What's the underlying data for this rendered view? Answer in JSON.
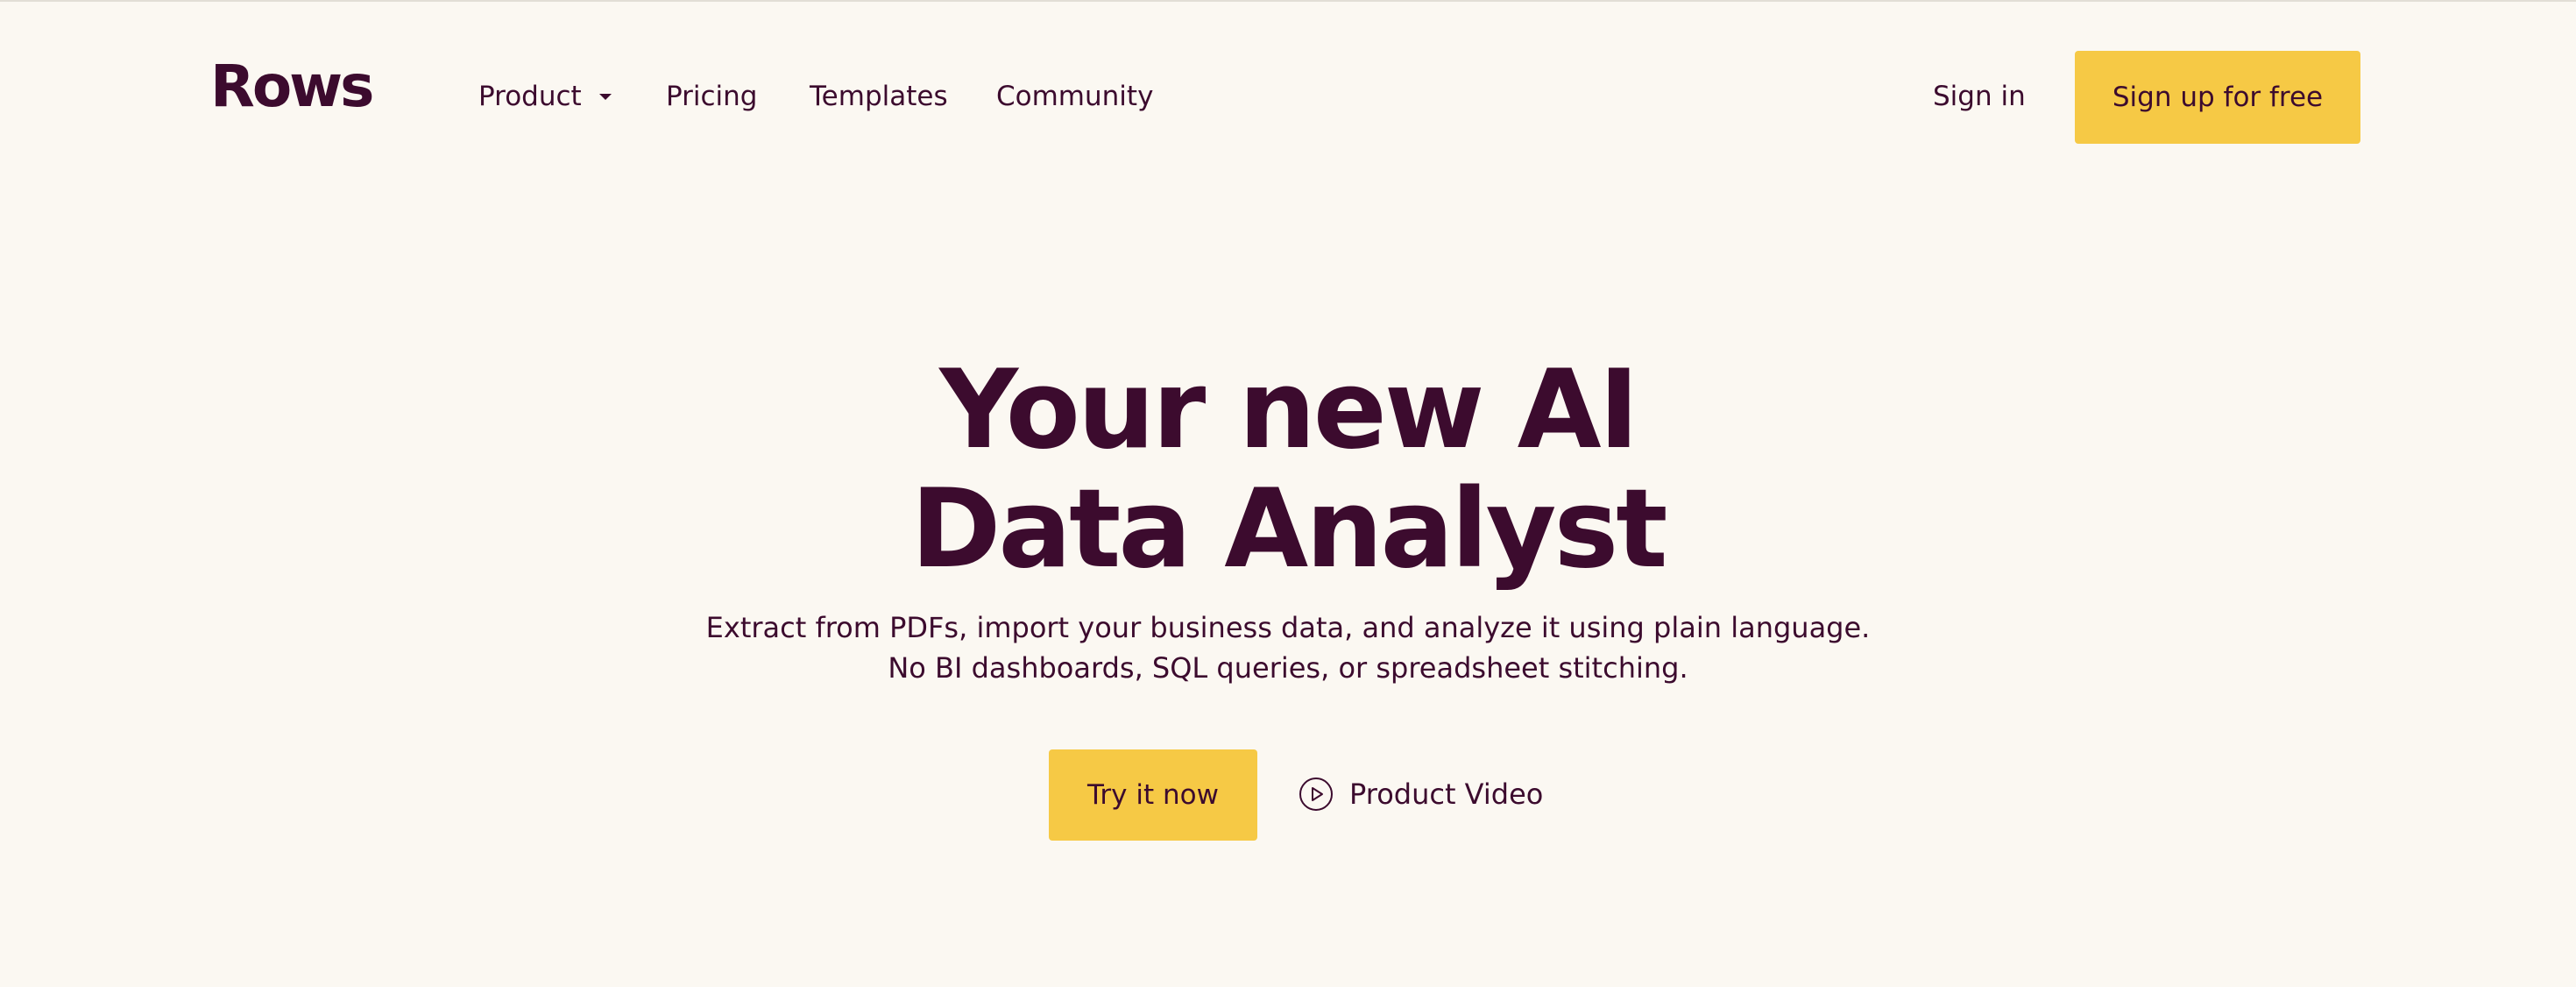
{
  "brand": {
    "logo_text": "Rows",
    "primary_color": "#3c0b2e",
    "accent_color": "#f6c945",
    "background_color": "#fbf8f2"
  },
  "nav": {
    "items": [
      {
        "label": "Product",
        "has_dropdown": true
      },
      {
        "label": "Pricing"
      },
      {
        "label": "Templates"
      },
      {
        "label": "Community"
      }
    ],
    "sign_in": "Sign in",
    "sign_up": "Sign up for free"
  },
  "hero": {
    "headline_line1": "Your new AI",
    "headline_line2": "Data Analyst",
    "subtext_line1": "Extract from PDFs, import your business data, and analyze it using plain language.",
    "subtext_line2": "No BI dashboards, SQL queries, or spreadsheet stitching.",
    "primary_cta": "Try it now",
    "secondary_cta": "Product Video",
    "secondary_cta_icon": "play-circle-icon"
  }
}
